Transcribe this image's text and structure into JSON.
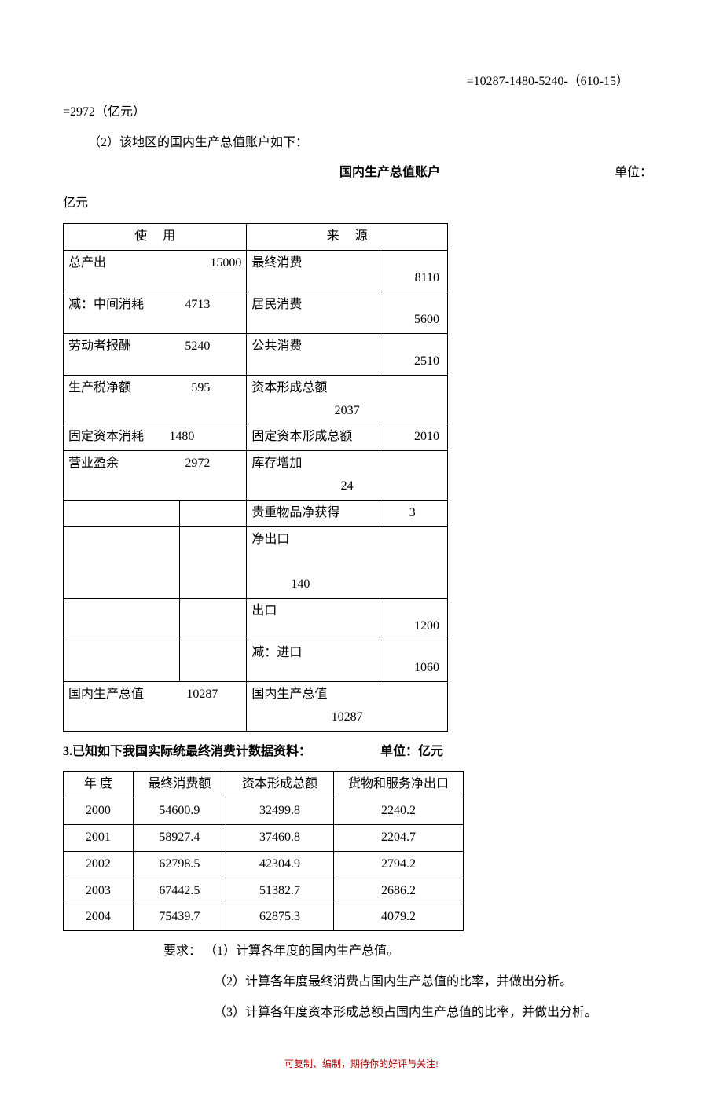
{
  "eq_line": "=10287-1480-5240-（610-15）",
  "eq_result": "=2972（亿元）",
  "para2": "（2）该地区的国内生产总值账户如下：",
  "table1_title": "国内生产总值账户",
  "table1_unit_pre": "单位：",
  "table1_unit_suf": "亿元",
  "gdp": {
    "head_left": "使用",
    "head_right": "来源",
    "left_rows": [
      {
        "label": "总产出",
        "value": "15000"
      },
      {
        "label": "减：中间消耗",
        "value": "4713"
      },
      {
        "label": "劳动者报酬",
        "value": "5240"
      },
      {
        "label": "生产税净额",
        "value": "595"
      },
      {
        "label": "固定资本消耗",
        "value": "1480"
      },
      {
        "label": "营业盈余",
        "value": "2972"
      }
    ],
    "left_total": {
      "label": "国内生产总值",
      "value": "10287"
    },
    "right_rows": [
      {
        "label": "最终消费",
        "value": "8110"
      },
      {
        "label": "居民消费",
        "value": "5600"
      },
      {
        "label": "公共消费",
        "value": "2510"
      },
      {
        "label": "资本形成总额",
        "value": "2037"
      },
      {
        "label": "固定资本形成总额",
        "value": "2010"
      },
      {
        "label": "库存增加",
        "value": "24"
      },
      {
        "label": "贵重物品净获得",
        "value": "3"
      },
      {
        "label": "净出口",
        "value": "140"
      },
      {
        "label": "出口",
        "value": "1200"
      },
      {
        "label": "减：进口",
        "value": "1060"
      }
    ],
    "right_total": {
      "label": "国内生产总值",
      "value": "10287"
    }
  },
  "section3_title": "3.已知如下我国实际统最终消费计数据资料：",
  "section3_unit": "单位：亿元",
  "table2": {
    "headers": [
      "年 度",
      "最终消费额",
      "资本形成总额",
      "货物和服务净出口"
    ],
    "rows": [
      [
        "2000",
        "54600.9",
        "32499.8",
        "2240.2"
      ],
      [
        "2001",
        "58927.4",
        "37460.8",
        "2204.7"
      ],
      [
        "2002",
        "62798.5",
        "42304.9",
        "2794.2"
      ],
      [
        "2003",
        "67442.5",
        "51382.7",
        "2686.2"
      ],
      [
        "2004",
        "75439.7",
        "62875.3",
        "4079.2"
      ]
    ]
  },
  "req_label": "要求：",
  "req1": "（1）计算各年度的国内生产总值。",
  "req2": "（2）计算各年度最终消费占国内生产总值的比率，并做出分析。",
  "req3": "（3）计算各年度资本形成总额占国内生产总值的比率，并做出分析。",
  "footer": "可复制、编制，期待你的好评与关注!"
}
